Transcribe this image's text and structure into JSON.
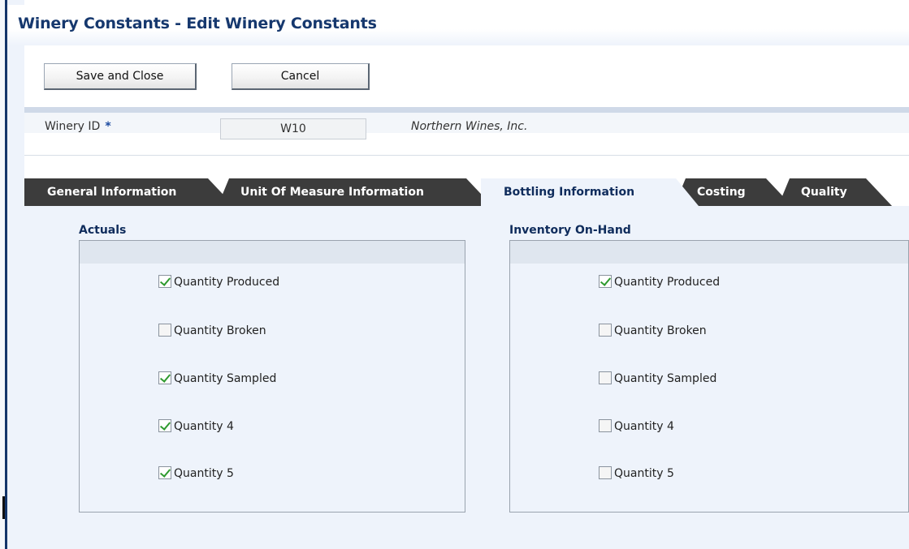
{
  "page": {
    "title": "Winery Constants - Edit Winery Constants"
  },
  "toolbar": {
    "save_close_label": "Save and Close",
    "cancel_label": "Cancel"
  },
  "header": {
    "winery_id_label": "Winery ID",
    "required_marker": "*",
    "winery_id_value": "W10",
    "winery_name": "Northern Wines, Inc."
  },
  "tabs": [
    {
      "label": "General Information",
      "active": false
    },
    {
      "label": "Unit Of Measure Information",
      "active": false
    },
    {
      "label": "Bottling Information",
      "active": true
    },
    {
      "label": "Costing",
      "active": false
    },
    {
      "label": "Quality",
      "active": false
    }
  ],
  "groups": {
    "actuals": {
      "title": "Actuals",
      "items": [
        {
          "label": "Quantity Produced",
          "checked": true
        },
        {
          "label": "Quantity Broken",
          "checked": false
        },
        {
          "label": "Quantity Sampled",
          "checked": true
        },
        {
          "label": "Quantity 4",
          "checked": true
        },
        {
          "label": "Quantity 5",
          "checked": true
        }
      ]
    },
    "inventory": {
      "title": "Inventory On-Hand",
      "items": [
        {
          "label": "Quantity Produced",
          "checked": true
        },
        {
          "label": "Quantity Broken",
          "checked": false
        },
        {
          "label": "Quantity Sampled",
          "checked": false
        },
        {
          "label": "Quantity 4",
          "checked": false
        },
        {
          "label": "Quantity 5",
          "checked": false
        }
      ]
    }
  },
  "colors": {
    "title": "#16386e",
    "tab_inactive": "#3c3c3c",
    "panel_bg": "#eef3fb",
    "check": "#2f9a2f"
  }
}
